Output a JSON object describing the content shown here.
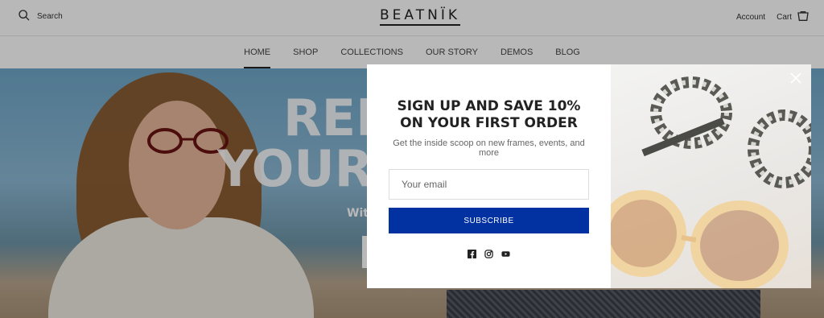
{
  "header": {
    "search_label": "Search",
    "logo": "BEATNÏK",
    "account_label": "Account",
    "cart_label": "Cart"
  },
  "nav": {
    "items": [
      {
        "label": "HOME",
        "active": true
      },
      {
        "label": "SHOP"
      },
      {
        "label": "COLLECTIONS"
      },
      {
        "label": "OUR STORY"
      },
      {
        "label": "DEMOS"
      },
      {
        "label": "BLOG"
      }
    ]
  },
  "hero": {
    "line1": "REF",
    "line2": "YOUR",
    "line3": "Wit"
  },
  "modal": {
    "title": "SIGN UP AND SAVE 10% ON YOUR FIRST ORDER",
    "subtitle": "Get the inside scoop on new frames, events, and more",
    "email_placeholder": "Your email",
    "subscribe_label": "SUBSCRIBE",
    "social": [
      "facebook-icon",
      "instagram-icon",
      "youtube-icon"
    ],
    "accent_color": "#0232a2"
  }
}
